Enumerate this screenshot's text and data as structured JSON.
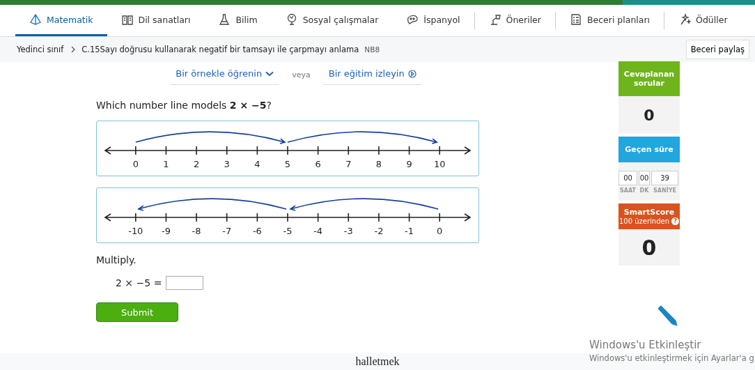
{
  "nav": {
    "tabs": [
      {
        "label": "Matematik",
        "selected": true
      },
      {
        "label": "Dil sanatları",
        "selected": false
      },
      {
        "label": "Bilim",
        "selected": false
      },
      {
        "label": "Sosyal çalışmalar",
        "selected": false
      },
      {
        "label": "İspanyol",
        "selected": false
      },
      {
        "label": "Öneriler",
        "selected": false
      },
      {
        "label": "Beceri planları",
        "selected": false
      },
      {
        "label": "Ödüller",
        "selected": false
      }
    ]
  },
  "breadcrumb": {
    "grade": "Yedinci sınıf",
    "skill": "C.15Sayı doğrusu kullanarak negatif bir tamsayı ile çarpmayı anlama",
    "code": "NB8",
    "share": "Beceri paylaş"
  },
  "help": {
    "example": "Bir örnekle öğrenin",
    "or": "veya",
    "video": "Bir eğitim izleyin"
  },
  "question": "Which number line models **2 × −5**?",
  "options": [
    {
      "selected": false,
      "kind": "forward",
      "labels": [
        "0",
        "1",
        "2",
        "3",
        "4",
        "5",
        "6",
        "7",
        "8",
        "9",
        "10"
      ]
    },
    {
      "selected": false,
      "kind": "backward",
      "labels": [
        "-10",
        "-9",
        "-8",
        "-7",
        "-6",
        "-5",
        "-4",
        "-3",
        "-2",
        "-1",
        "0"
      ]
    }
  ],
  "prompt": "Multiply.",
  "equation": "2 × −5 =",
  "submit": "Submit",
  "sidebar": {
    "answered_label": "Cevaplanan sorular",
    "answered": "0",
    "time_label": "Geçen süre",
    "timer": [
      {
        "value": "00",
        "unit": "SAAT"
      },
      {
        "value": "00",
        "unit": "DK"
      },
      {
        "value": "39",
        "unit": "SANİYE"
      }
    ],
    "score_label": "SmartScore",
    "score_sub": "100 üzerinden",
    "score_help": "?",
    "score": "0"
  },
  "footer": "halletmek",
  "activation": {
    "title": "Windows'u Etkinleştir",
    "text": "Windows'u etkinleştirmek için Ayarlar'a g"
  }
}
